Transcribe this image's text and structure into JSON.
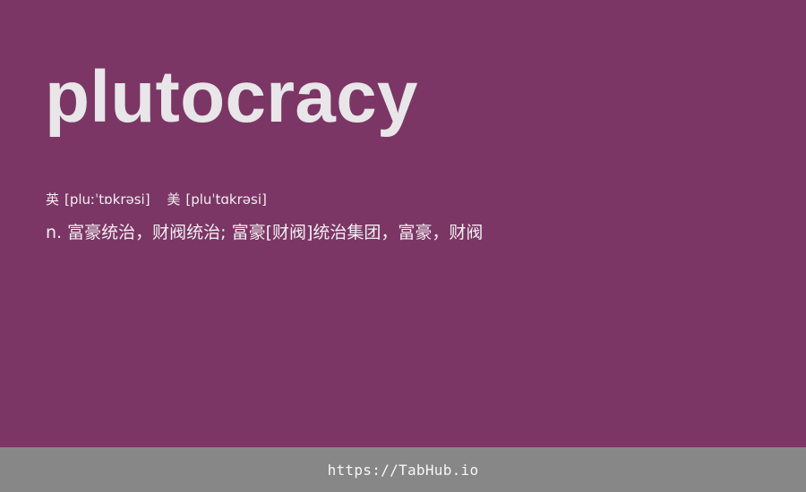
{
  "word": "plutocracy",
  "phonetics": {
    "uk": {
      "label": "英",
      "ipa": "[pluːˈtɒkrəsi]"
    },
    "us": {
      "label": "美",
      "ipa": "[pluˈtɑkrəsi]"
    }
  },
  "definition": "n. 富豪统治，财阀统治; 富豪[财阀]统治集团，富豪，财阀",
  "footer": {
    "link_text": "https://TabHub.io"
  },
  "colors": {
    "background": "#7b3665",
    "footer": "#878787",
    "text": "#e8e6e8"
  }
}
